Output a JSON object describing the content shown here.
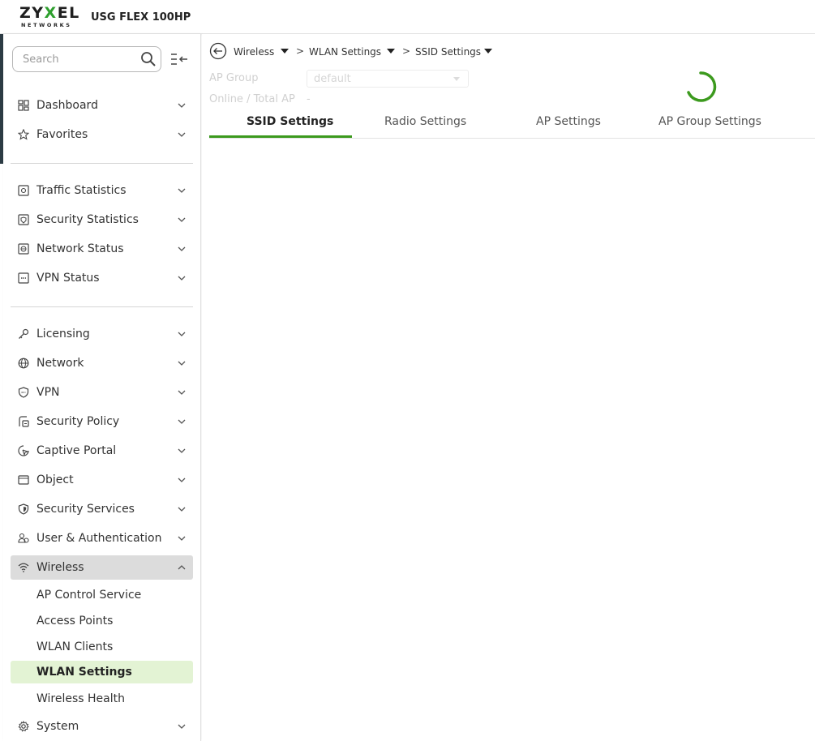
{
  "header": {
    "logo_top": "ZY",
    "logo_x": "X",
    "logo_rest": "EL",
    "logo_sub": "NETWORKS",
    "model": "USG FLEX 100HP"
  },
  "sidebar": {
    "search_placeholder": "Search",
    "items": {
      "dashboard": "Dashboard",
      "favorites": "Favorites",
      "traffic_statistics": "Traffic Statistics",
      "security_statistics": "Security Statistics",
      "network_status": "Network Status",
      "vpn_status": "VPN Status",
      "licensing": "Licensing",
      "network": "Network",
      "vpn": "VPN",
      "security_policy": "Security Policy",
      "captive_portal": "Captive Portal",
      "object": "Object",
      "security_services": "Security Services",
      "user_authentication": "User & Authentication",
      "wireless": "Wireless",
      "system": "System"
    },
    "wireless_sub": {
      "ap_control_service": "AP Control Service",
      "access_points": "Access Points",
      "wlan_clients": "WLAN Clients",
      "wlan_settings": "WLAN Settings",
      "wireless_health": "Wireless Health"
    }
  },
  "main": {
    "breadcrumb": [
      "Wireless",
      "WLAN Settings",
      "SSID Settings"
    ],
    "separator": ">",
    "ap_group_label": "AP Group",
    "ap_group_value": "default",
    "online_total_label": "Online / Total AP",
    "online_total_value": "-",
    "tabs": [
      "SSID Settings",
      "Radio Settings",
      "AP Settings",
      "AP Group Settings"
    ],
    "active_tab": "SSID Settings"
  },
  "colors": {
    "accent_green": "#3c9a1e",
    "selected_bg": "#e3f3d4",
    "active_parent_bg": "#dcdcdc"
  }
}
